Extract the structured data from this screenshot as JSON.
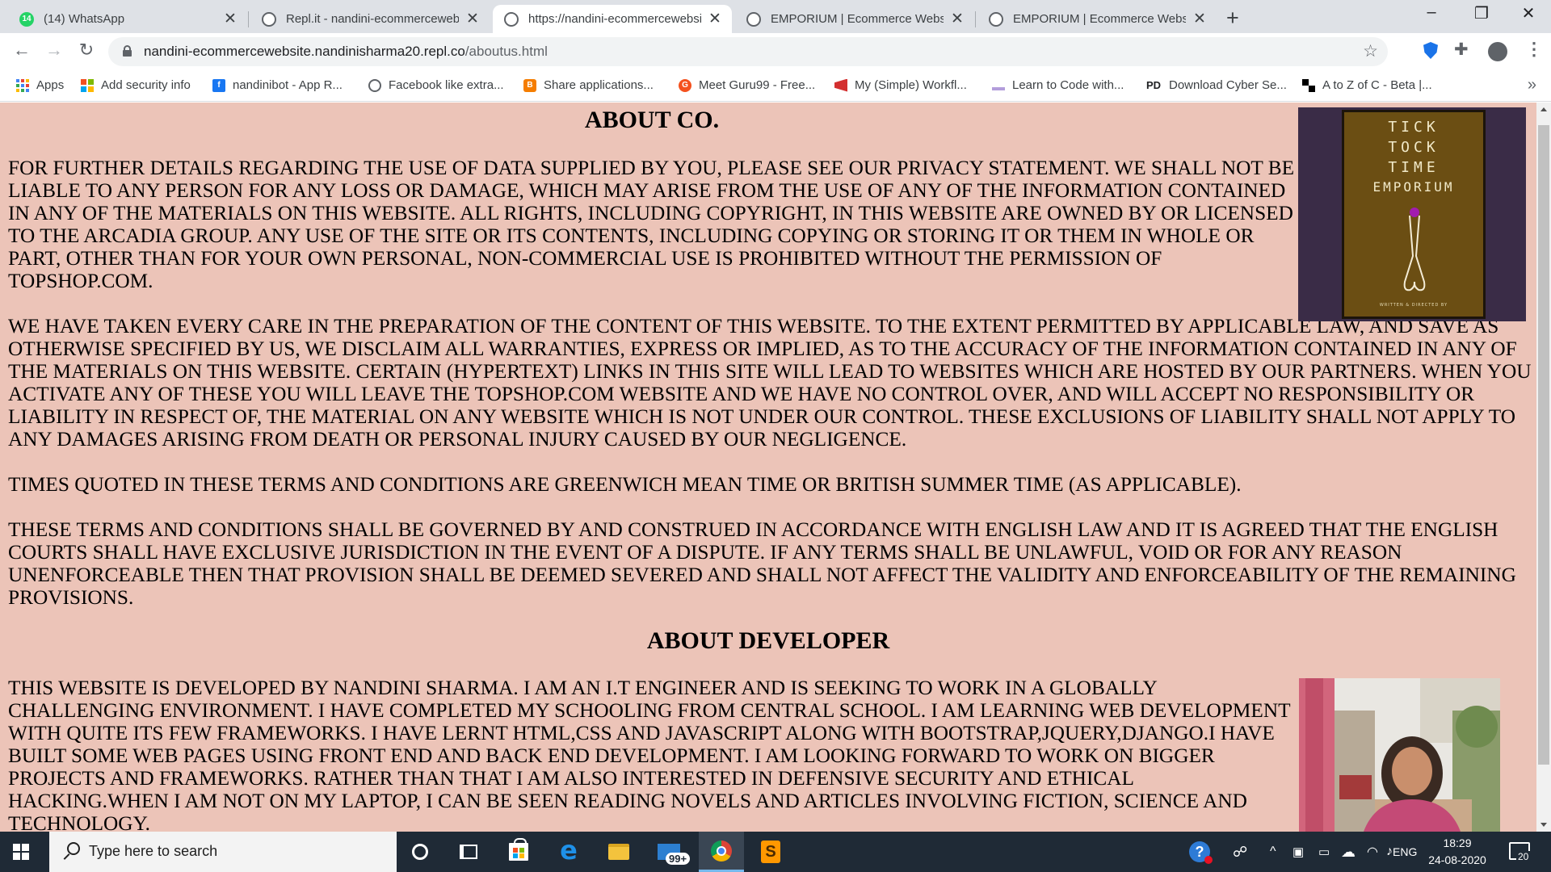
{
  "browser": {
    "tabs": [
      {
        "title": "(14) WhatsApp",
        "favicon": "whatsapp-icon",
        "badge": "14"
      },
      {
        "title": "Repl.it - nandini-ecommercewebsite",
        "favicon": "replit-icon"
      },
      {
        "title": "https://nandini-ecommercewebsite",
        "favicon": "globe-icon",
        "active": true
      },
      {
        "title": "EMPORIUM | Ecommerce Website",
        "favicon": "globe-icon"
      },
      {
        "title": "EMPORIUM | Ecommerce Website",
        "favicon": "globe-icon"
      }
    ],
    "address": {
      "host": "nandini-ecommercewebsite.nandinisharma20.repl.co",
      "path": "/aboutus.html"
    },
    "bookmarks": [
      {
        "label": "Apps",
        "icon": "apps-grid-icon"
      },
      {
        "label": "Add security info",
        "icon": "microsoft-icon"
      },
      {
        "label": "nandinibot - App R...",
        "icon": "facebook-icon",
        "color": "#1877f2"
      },
      {
        "label": "Facebook like extra...",
        "icon": "globe-icon"
      },
      {
        "label": "Share applications...",
        "icon": "blogger-icon",
        "color": "#f57d00"
      },
      {
        "label": "Meet Guru99 - Free...",
        "icon": "guru99-icon",
        "color": "#f4511e"
      },
      {
        "label": "My (Simple) Workfl...",
        "icon": "workflow-icon",
        "color": "#d32f2f"
      },
      {
        "label": "Learn to Code with...",
        "icon": "code-icon",
        "color": "#7e57c2"
      },
      {
        "label": "Download Cyber Se...",
        "icon": "pd-icon",
        "color": "#202124"
      },
      {
        "label": "A to Z of C - Beta |...",
        "icon": "blocks-icon",
        "color": "#000000"
      }
    ]
  },
  "page": {
    "about_title": "ABOUT CO.",
    "paragraphs": [
      "FOR FURTHER DETAILS REGARDING THE USE OF DATA SUPPLIED BY YOU, PLEASE SEE OUR PRIVACY STATEMENT. WE SHALL NOT BE LIABLE TO ANY PERSON FOR ANY LOSS OR DAMAGE, WHICH MAY ARISE FROM THE USE OF ANY OF THE INFORMATION CONTAINED IN ANY OF THE MATERIALS ON THIS WEBSITE. ALL RIGHTS, INCLUDING COPYRIGHT, IN THIS WEBSITE ARE OWNED BY OR LICENSED TO THE ARCADIA GROUP. ANY USE OF THE SITE OR ITS CONTENTS, INCLUDING COPYING OR STORING IT OR THEM IN WHOLE OR PART, OTHER THAN FOR YOUR OWN PERSONAL, NON-COMMERCIAL USE IS PROHIBITED WITHOUT THE PERMISSION OF TOPSHOP.COM.",
      "WE HAVE TAKEN EVERY CARE IN THE PREPARATION OF THE CONTENT OF THIS WEBSITE. TO THE EXTENT PERMITTED BY APPLICABLE LAW, AND SAVE AS OTHERWISE SPECIFIED BY US, WE DISCLAIM ALL WARRANTIES, EXPRESS OR IMPLIED, AS TO THE ACCURACY OF THE INFORMATION CONTAINED IN ANY OF THE MATERIALS ON THIS WEBSITE. CERTAIN (HYPERTEXT) LINKS IN THIS SITE WILL LEAD TO WEBSITES WHICH ARE HOSTED BY OUR PARTNERS. WHEN YOU ACTIVATE ANY OF THESE YOU WILL LEAVE THE TOPSHOP.COM WEBSITE AND WE HAVE NO CONTROL OVER, AND WILL ACCEPT NO RESPONSIBILITY OR LIABILITY IN RESPECT OF, THE MATERIAL ON ANY WEBSITE WHICH IS NOT UNDER OUR CONTROL. THESE EXCLUSIONS OF LIABILITY SHALL NOT APPLY TO ANY DAMAGES ARISING FROM DEATH OR PERSONAL INJURY CAUSED BY OUR NEGLIGENCE.",
      "TIMES QUOTED IN THESE TERMS AND CONDITIONS ARE GREENWICH MEAN TIME OR BRITISH SUMMER TIME (AS APPLICABLE).",
      "THESE TERMS AND CONDITIONS SHALL BE GOVERNED BY AND CONSTRUED IN ACCORDANCE WITH ENGLISH LAW AND IT IS AGREED THAT THE ENGLISH COURTS SHALL HAVE EXCLUSIVE JURISDICTION IN THE EVENT OF A DISPUTE. IF ANY TERMS SHALL BE UNLAWFUL, VOID OR FOR ANY REASON UNENFORCEABLE THEN THAT PROVISION SHALL BE DEEMED SEVERED AND SHALL NOT AFFECT THE VALIDITY AND ENFORCEABILITY OF THE REMAINING PROVISIONS."
    ],
    "developer_title": "ABOUT DEVELOPER",
    "developer_text": "THIS WEBSITE IS DEVELOPED BY NANDINI SHARMA. I AM AN I.T ENGINEER AND IS SEEKING TO WORK IN A GLOBALLY CHALLENGING ENVIRONMENT. I HAVE COMPLETED MY SCHOOLING FROM CENTRAL SCHOOL. I AM LEARNING WEB DEVELOPMENT WITH QUITE ITS FEW FRAMEWORKS. I HAVE LERNT HTML,CSS AND JAVASCRIPT ALONG WITH BOOTSTRAP,JQUERY,DJANGO.I HAVE BUILT SOME WEB PAGES USING FRONT END AND BACK END DEVELOPMENT. I AM LOOKING FORWARD TO WORK ON BIGGER PROJECTS AND FRAMEWORKS. RATHER THAN THAT I AM ALSO INTERESTED IN DEFENSIVE SECURITY AND ETHICAL HACKING.WHEN I AM NOT ON MY LAPTOP, I CAN BE SEEN READING NOVELS AND ARTICLES INVOLVING FICTION, SCIENCE AND TECHNOLOGY.",
    "logo": {
      "lines": [
        "TICK",
        "TOCK",
        "TIME",
        "EMPORIUM"
      ],
      "credit": "WRITTEN & DIRECTED BY"
    },
    "background_color": "#ecc4b8"
  },
  "taskbar": {
    "search_placeholder": "Type here to search",
    "mail_badge": "99+",
    "language": "ENG",
    "time": "18:29",
    "date": "24-08-2020",
    "notification_count": "20"
  }
}
